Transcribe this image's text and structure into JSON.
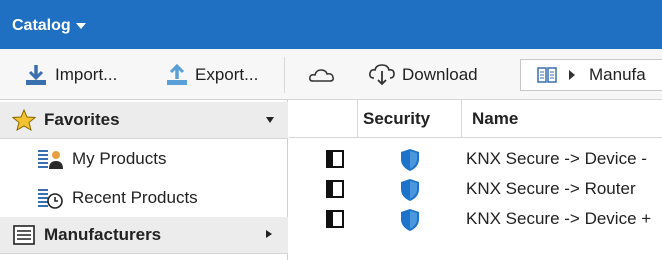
{
  "menu": {
    "catalog_label": "Catalog"
  },
  "toolbar": {
    "import_label": "Import...",
    "export_label": "Export...",
    "cloud_icon": "cloud-icon",
    "download_label": "Download",
    "breadcrumb_text": "Manufa"
  },
  "sidebar": {
    "favorites_label": "Favorites",
    "items": [
      {
        "label": "My Products",
        "icon": "my-products-icon"
      },
      {
        "label": "Recent Products",
        "icon": "recent-products-icon"
      }
    ],
    "manufacturers_label": "Manufacturers"
  },
  "grid": {
    "columns": [
      "",
      "Security",
      "Name"
    ],
    "rows": [
      {
        "name": "KNX Secure -> Device -",
        "security": "shield-icon"
      },
      {
        "name": "KNX Secure -> Router",
        "security": "shield-icon"
      },
      {
        "name": "KNX Secure -> Device +",
        "security": "shield-icon"
      }
    ]
  },
  "colors": {
    "titlebar": "#1f6fc2",
    "accent": "#2b7bd0",
    "shield": "#1d73c9",
    "star": "#f2c230"
  }
}
